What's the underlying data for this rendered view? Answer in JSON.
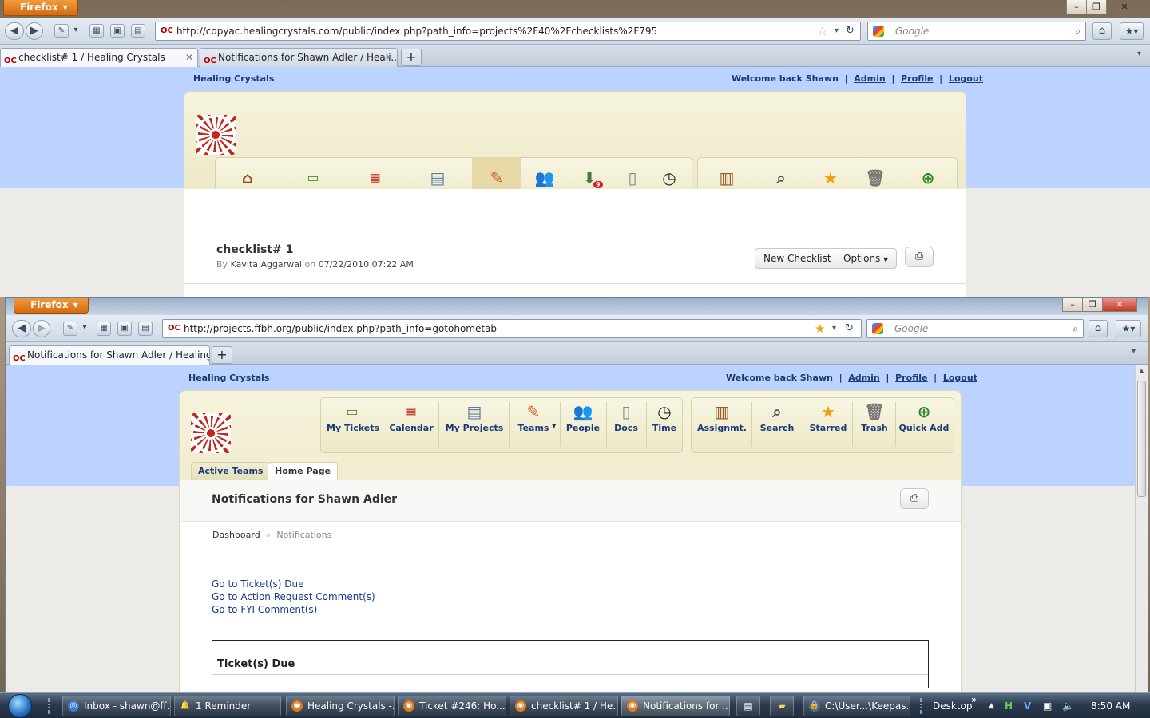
{
  "back_window": {
    "menu_button": "Firefox",
    "url": "http://copyac.healingcrystals.com/public/index.php?path_info=projects%2F40%2Fchecklists%2F795",
    "search_placeholder": "Google",
    "tabs": [
      {
        "label": "checklist# 1 / Healing Crystals",
        "active": true
      },
      {
        "label": "Notifications for Shawn Adler / Heali...",
        "active": false
      }
    ],
    "site_name": "Healing Crystals",
    "welcome": "Welcome back Shawn",
    "links": [
      "Admin",
      "Profile",
      "Logout"
    ],
    "nav_icons": [
      "home-icon",
      "today-icon",
      "calendar-icon",
      "projects-icon",
      "teams-icon",
      "people-icon",
      "inbox-icon",
      "docs-icon",
      "time-icon",
      "assignments-icon",
      "search-icon",
      "starred-icon",
      "trash-icon",
      "quick-add-icon"
    ],
    "inbox_badge": "9",
    "page_title": "checklist# 1",
    "by_label": "By",
    "author": "Kavita Aggarwal",
    "on_label": "on",
    "date": "07/22/2010 07:22 AM",
    "new_checklist_btn": "New Checklist",
    "options_btn": "Options"
  },
  "front_window": {
    "menu_button": "Firefox",
    "url": "http://projects.ffbh.org/public/index.php?path_info=gotohometab",
    "search_placeholder": "Google",
    "tab_label": "Notifications for Shawn Adler / Healing ...",
    "site_name": "Healing Crystals",
    "welcome": "Welcome back Shawn",
    "links": [
      "Admin",
      "Profile",
      "Logout"
    ],
    "nav_main": [
      {
        "label": "My Tickets",
        "icon": "today-icon"
      },
      {
        "label": "Calendar",
        "icon": "calendar-icon"
      },
      {
        "label": "My Projects",
        "icon": "projects-icon"
      },
      {
        "label": "Teams",
        "icon": "teams-icon"
      },
      {
        "label": "People",
        "icon": "people-icon"
      },
      {
        "label": "Docs",
        "icon": "docs-icon"
      },
      {
        "label": "Time",
        "icon": "time-icon"
      }
    ],
    "nav_tools": [
      {
        "label": "Assignmt.",
        "icon": "assignments-icon"
      },
      {
        "label": "Search",
        "icon": "search-icon"
      },
      {
        "label": "Starred",
        "icon": "starred-icon"
      },
      {
        "label": "Trash",
        "icon": "trash-icon"
      },
      {
        "label": "Quick Add",
        "icon": "quick-add-icon"
      }
    ],
    "subtabs": [
      {
        "label": "Active Teams",
        "active": false
      },
      {
        "label": "Home Page",
        "active": true
      }
    ],
    "page_title": "Notifications for Shawn Adler",
    "breadcrumb": [
      "Dashboard",
      "Notifications"
    ],
    "quick_links": [
      "Go to Ticket(s) Due",
      "Go to Action Request Comment(s)",
      "Go to FYI Comment(s)"
    ],
    "section_title": "Ticket(s) Due"
  },
  "taskbar": {
    "tasks": [
      {
        "label": "Inbox - shawn@ff...",
        "active": false
      },
      {
        "label": "1 Reminder",
        "active": false
      },
      {
        "label": "Healing Crystals -...",
        "active": false
      },
      {
        "label": "Ticket #246: Ho...",
        "active": false
      },
      {
        "label": "checklist# 1 / He...",
        "active": false
      },
      {
        "label": "Notifications for ...",
        "active": true
      },
      {
        "label": "C:\\User...\\Keepas...",
        "active": false
      }
    ],
    "desktop_label": "Desktop",
    "time": "8:50 AM"
  }
}
